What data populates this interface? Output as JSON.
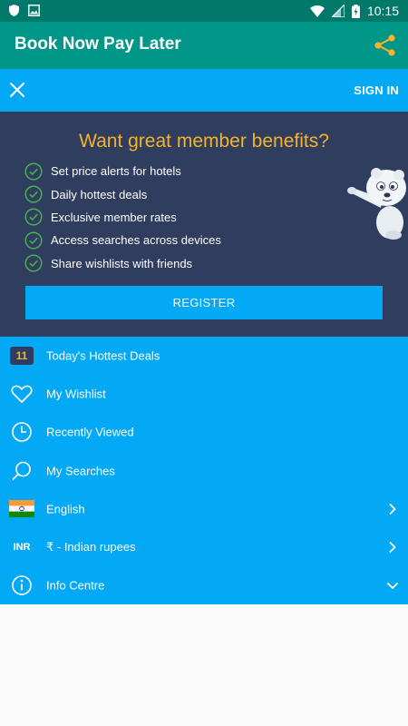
{
  "status_bar": {
    "time": "10:15",
    "icons": [
      "shield-icon",
      "image-icon",
      "wifi-icon",
      "signal-icon",
      "battery-charging-icon"
    ]
  },
  "app_bar": {
    "title": "Book Now Pay Later",
    "share_icon": "share-icon"
  },
  "menu_header": {
    "close_icon": "close-icon",
    "sign_in": "SIGN IN"
  },
  "promo": {
    "title": "Want great member benefits?",
    "benefits": [
      "Set price alerts for hotels",
      "Daily hottest deals",
      "Exclusive member rates",
      "Access searches across devices",
      "Share wishlists with friends"
    ],
    "register": "REGISTER"
  },
  "menu": {
    "items": [
      {
        "label": "Today's Hottest Deals",
        "badge": "11"
      },
      {
        "label": "My Wishlist",
        "icon": "heart-icon"
      },
      {
        "label": "Recently Viewed",
        "icon": "clock-icon"
      },
      {
        "label": "My Searches",
        "icon": "search-icon"
      },
      {
        "label": "English",
        "icon": "india-flag-icon",
        "trailing": "chevron-right-icon"
      },
      {
        "label": "₹ - Indian rupees",
        "code": "INR",
        "trailing": "chevron-right-icon"
      },
      {
        "label": "Info Centre",
        "icon": "info-icon",
        "trailing": "chevron-down-icon"
      }
    ]
  },
  "colors": {
    "status_bar": "#00796b",
    "app_bar": "#009688",
    "menu_blue": "#03a9f4",
    "promo_navy": "#2f3d5e",
    "accent_yellow": "#f5b32b",
    "check_green": "#4caf50"
  }
}
